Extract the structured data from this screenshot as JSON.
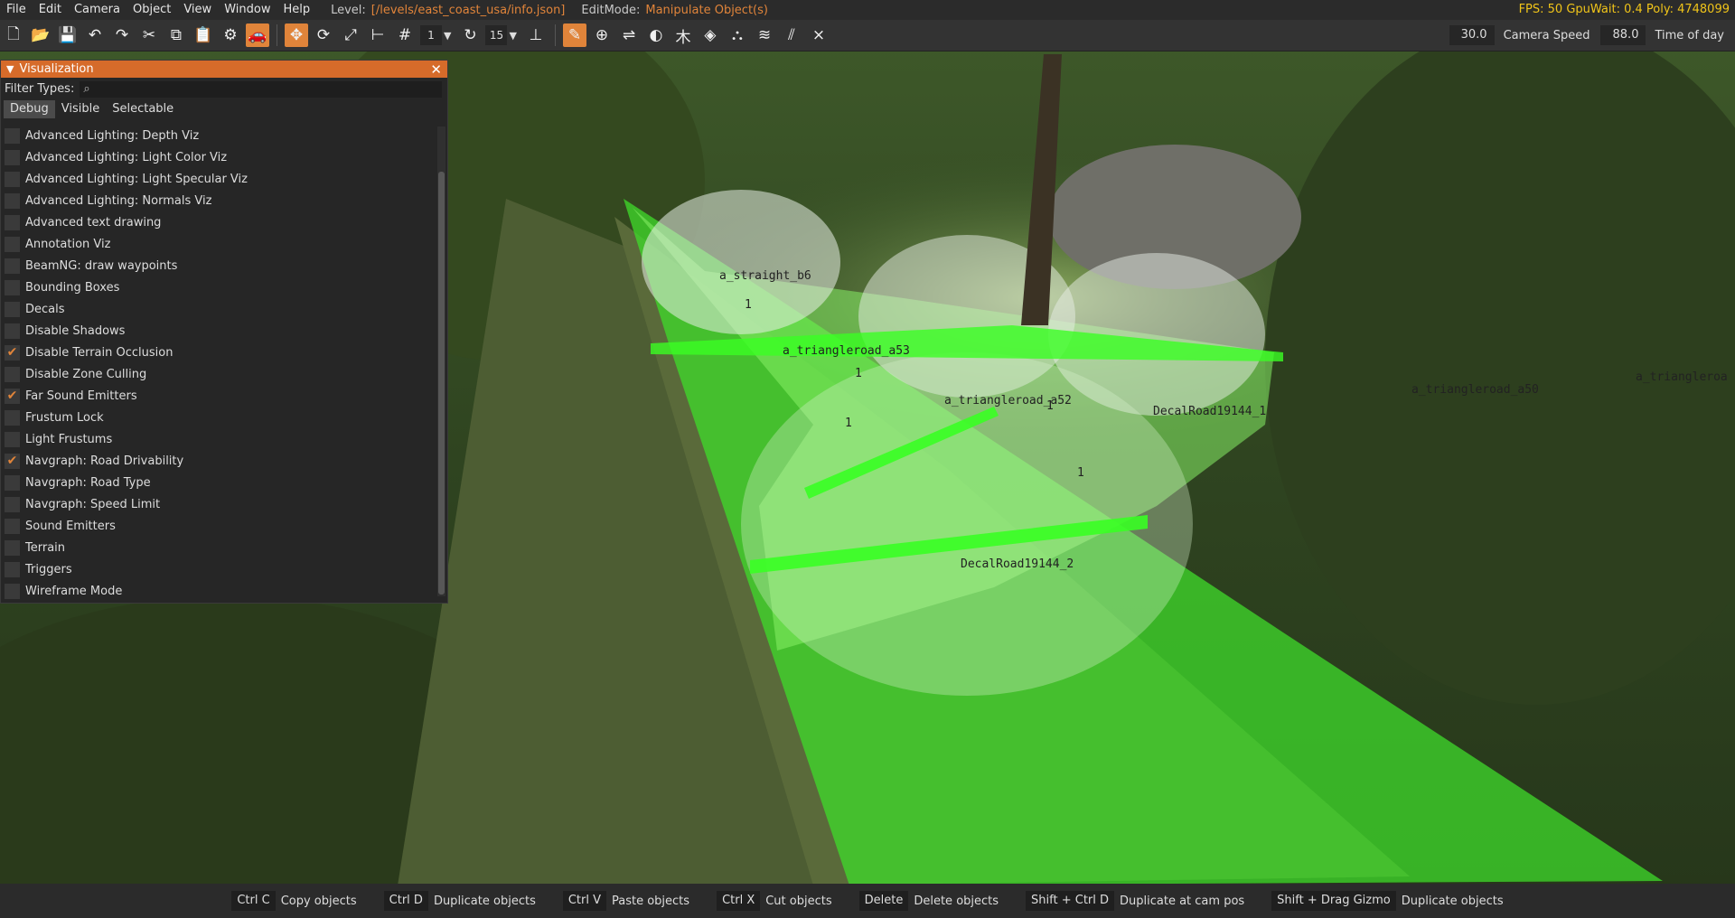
{
  "menu": {
    "items": [
      "File",
      "Edit",
      "Camera",
      "Object",
      "View",
      "Window",
      "Help"
    ],
    "level_label": "Level:",
    "level_value": "[/levels/east_coast_usa/info.json]",
    "editmode_label": "EditMode:",
    "editmode_value": "Manipulate Object(s)",
    "perf": "FPS: 50  GpuWait: 0.4  Poly: 4748099"
  },
  "toolbar": {
    "snap_value": "1",
    "rotate_value": "15",
    "camera_speed_value": "30.0",
    "camera_speed_label": "Camera Speed",
    "time_value": "88.0",
    "time_label": "Time of day"
  },
  "viz": {
    "title": "Visualization",
    "filter_label": "Filter Types:",
    "tabs": [
      "Debug",
      "Visible",
      "Selectable"
    ],
    "items": [
      {
        "label": "Advanced Lighting: Depth Viz",
        "checked": false
      },
      {
        "label": "Advanced Lighting: Light Color Viz",
        "checked": false
      },
      {
        "label": "Advanced Lighting: Light Specular Viz",
        "checked": false
      },
      {
        "label": "Advanced Lighting: Normals Viz",
        "checked": false
      },
      {
        "label": "Advanced text drawing",
        "checked": false
      },
      {
        "label": "Annotation Viz",
        "checked": false
      },
      {
        "label": "BeamNG: draw waypoints",
        "checked": false
      },
      {
        "label": "Bounding Boxes",
        "checked": false
      },
      {
        "label": "Decals",
        "checked": false
      },
      {
        "label": "Disable Shadows",
        "checked": false
      },
      {
        "label": "Disable Terrain Occlusion",
        "checked": true
      },
      {
        "label": "Disable Zone Culling",
        "checked": false
      },
      {
        "label": "Far Sound Emitters",
        "checked": true
      },
      {
        "label": "Frustum Lock",
        "checked": false
      },
      {
        "label": "Light Frustums",
        "checked": false
      },
      {
        "label": "Navgraph: Road Drivability",
        "checked": true
      },
      {
        "label": "Navgraph: Road Type",
        "checked": false
      },
      {
        "label": "Navgraph: Speed Limit",
        "checked": false
      },
      {
        "label": "Sound Emitters",
        "checked": false
      },
      {
        "label": "Terrain",
        "checked": false
      },
      {
        "label": "Triggers",
        "checked": false
      },
      {
        "label": "Wireframe Mode",
        "checked": false
      }
    ]
  },
  "world_labels": {
    "straight_b6": "a_straight_b6",
    "triangle_a53": "a_triangleroad_a53",
    "triangle_a52": "a_triangleroad_a52",
    "decal_1": "DecalRoad19144_1",
    "decal_2": "DecalRoad19144_2",
    "one_a": "1",
    "one_b": "1",
    "one_c": "1",
    "one_d": "1",
    "one_e": "1",
    "triangle_a50": "a_triangleroad_a50",
    "triangle_far": "a_triangleroa"
  },
  "shortcuts": [
    {
      "key": "Ctrl C",
      "desc": "Copy objects"
    },
    {
      "key": "Ctrl D",
      "desc": "Duplicate objects"
    },
    {
      "key": "Ctrl V",
      "desc": "Paste objects"
    },
    {
      "key": "Ctrl X",
      "desc": "Cut objects"
    },
    {
      "key": "Delete",
      "desc": "Delete objects"
    },
    {
      "key": "Shift + Ctrl D",
      "desc": "Duplicate at cam pos"
    },
    {
      "key": "Shift + Drag Gizmo",
      "desc": "Duplicate objects"
    }
  ]
}
